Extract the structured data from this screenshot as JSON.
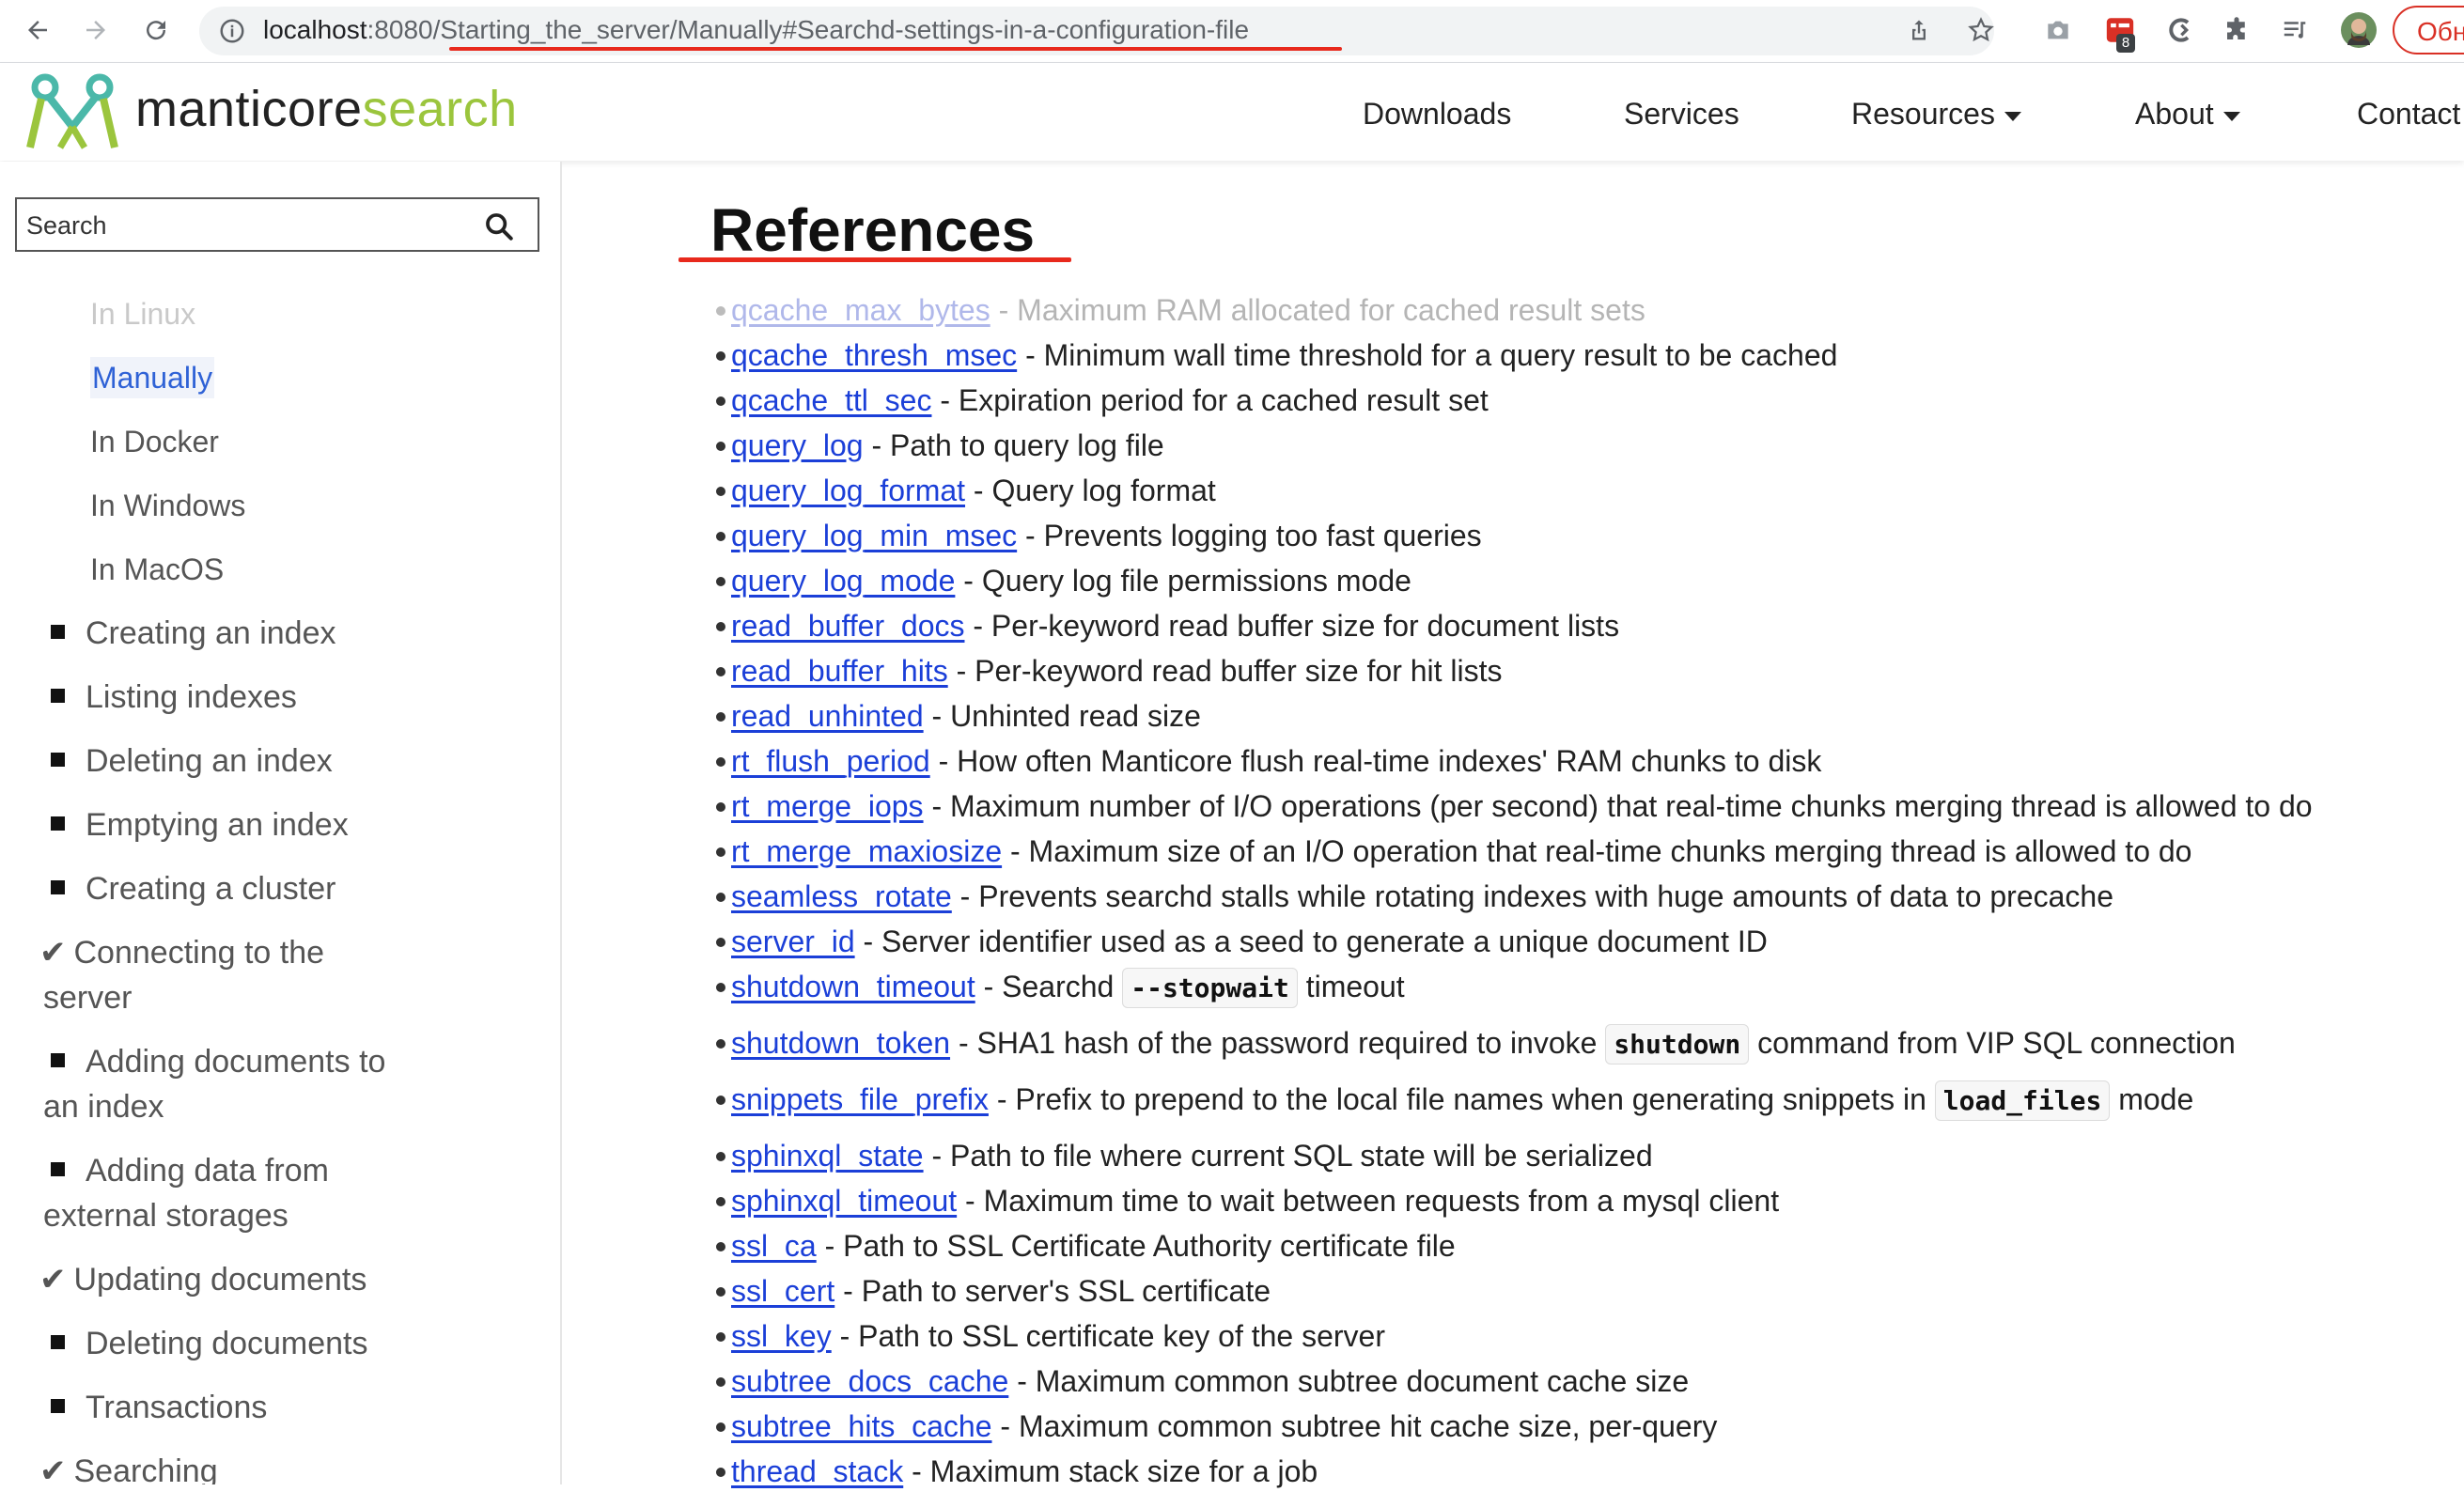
{
  "browser": {
    "url_host": "localhost",
    "url_rest": ":8080/Starting_the_server/Manually#Searchd-settings-in-a-configuration-file",
    "extension_badge": "8",
    "update_button": "Обн"
  },
  "header": {
    "logo_part1": "manticore",
    "logo_part2": "search",
    "nav": [
      "Downloads",
      "Services",
      "Resources",
      "About",
      "Contact"
    ]
  },
  "sidebar": {
    "search_placeholder": "Search",
    "sub_items": [
      "In Linux",
      "Manually",
      "In Docker",
      "In Windows",
      "In MacOS"
    ],
    "items": [
      {
        "label": "Creating an index",
        "marker": "square"
      },
      {
        "label": "Listing indexes",
        "marker": "square"
      },
      {
        "label": "Deleting an index",
        "marker": "square"
      },
      {
        "label": "Emptying an index",
        "marker": "square"
      },
      {
        "label": "Creating a cluster",
        "marker": "square"
      },
      {
        "label": "Connecting to the",
        "label2": "server",
        "marker": "check"
      },
      {
        "label": "Adding documents to",
        "label2": "an index",
        "marker": "square"
      },
      {
        "label": "Adding data from",
        "label2": "external storages",
        "marker": "square"
      },
      {
        "label": "Updating documents",
        "marker": "check"
      },
      {
        "label": "Deleting documents",
        "marker": "square"
      },
      {
        "label": "Transactions",
        "marker": "square"
      },
      {
        "label": "Searching",
        "marker": "check"
      }
    ],
    "check_glyph": "✔"
  },
  "main": {
    "title": "References",
    "refs": [
      {
        "name": "qcache_max_bytes",
        "desc": " - Maximum RAM allocated for cached result sets"
      },
      {
        "name": "qcache_thresh_msec",
        "desc": " - Minimum wall time threshold for a query result to be cached"
      },
      {
        "name": "qcache_ttl_sec",
        "desc": " - Expiration period for a cached result set"
      },
      {
        "name": "query_log",
        "desc": " - Path to query log file"
      },
      {
        "name": "query_log_format",
        "desc": " - Query log format"
      },
      {
        "name": "query_log_min_msec",
        "desc": " - Prevents logging too fast queries"
      },
      {
        "name": "query_log_mode",
        "desc": " - Query log file permissions mode"
      },
      {
        "name": "read_buffer_docs",
        "desc": " - Per-keyword read buffer size for document lists"
      },
      {
        "name": "read_buffer_hits",
        "desc": " - Per-keyword read buffer size for hit lists"
      },
      {
        "name": "read_unhinted",
        "desc": " - Unhinted read size"
      },
      {
        "name": "rt_flush_period",
        "desc": " - How often Manticore flush real-time indexes' RAM chunks to disk"
      },
      {
        "name": "rt_merge_iops",
        "desc": " - Maximum number of I/O operations (per second) that real-time chunks merging thread is allowed to do"
      },
      {
        "name": "rt_merge_maxiosize",
        "desc": " - Maximum size of an I/O operation that real-time chunks merging thread is allowed to do"
      },
      {
        "name": "seamless_rotate",
        "desc": " - Prevents searchd stalls while rotating indexes with huge amounts of data to precache"
      },
      {
        "name": "server_id",
        "desc": " - Server identifier used as a seed to generate a unique document ID"
      },
      {
        "name": "shutdown_timeout",
        "desc": " - Searchd ",
        "code": "--stopwait",
        "after": " timeout"
      },
      {
        "name": "shutdown_token",
        "desc": " - SHA1 hash of the password required to invoke ",
        "code": "shutdown",
        "after": " command from VIP SQL connection"
      },
      {
        "name": "snippets_file_prefix",
        "desc": " - Prefix to prepend to the local file names when generating snippets in ",
        "code": "load_files",
        "after": " mode"
      },
      {
        "name": "sphinxql_state",
        "desc": " - Path to file where current SQL state will be serialized"
      },
      {
        "name": "sphinxql_timeout",
        "desc": " - Maximum time to wait between requests from a mysql client"
      },
      {
        "name": "ssl_ca",
        "desc": " - Path to SSL Certificate Authority certificate file"
      },
      {
        "name": "ssl_cert",
        "desc": " - Path to server's SSL certificate"
      },
      {
        "name": "ssl_key",
        "desc": " - Path to SSL certificate key of the server"
      },
      {
        "name": "subtree_docs_cache",
        "desc": " - Maximum common subtree document cache size"
      },
      {
        "name": "subtree_hits_cache",
        "desc": " - Maximum common subtree hit cache size, per-query"
      },
      {
        "name": "thread_stack",
        "desc": " - Maximum stack size for a job"
      }
    ]
  }
}
